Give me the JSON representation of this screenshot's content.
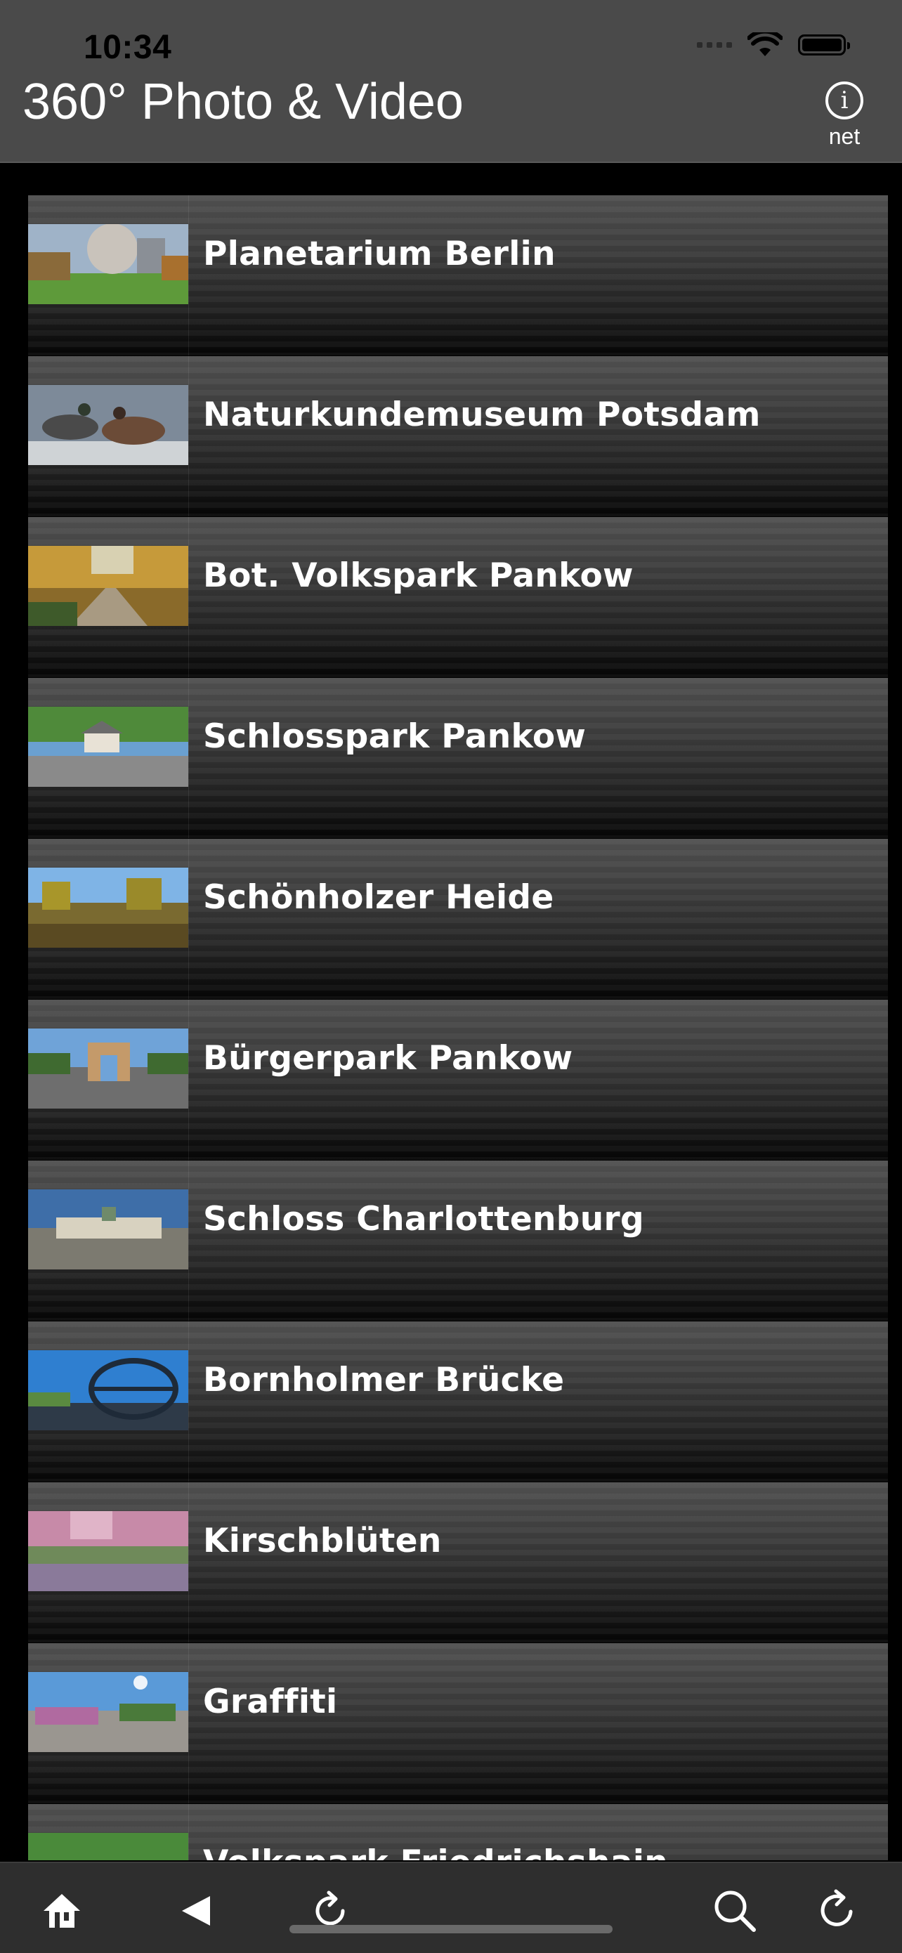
{
  "status_bar": {
    "time": "10:34"
  },
  "header": {
    "title": "360° Photo & Video",
    "info_button_label": "net"
  },
  "items": [
    {
      "label": "Planetarium Berlin"
    },
    {
      "label": "Naturkundemuseum Potsdam"
    },
    {
      "label": "Bot. Volkspark Pankow"
    },
    {
      "label": "Schlosspark Pankow"
    },
    {
      "label": "Schönholzer Heide"
    },
    {
      "label": "Bürgerpark Pankow"
    },
    {
      "label": "Schloss Charlottenburg"
    },
    {
      "label": "Bornholmer Brücke"
    },
    {
      "label": "Kirschblüten"
    },
    {
      "label": "Graffiti"
    },
    {
      "label": "Volkspark Friedrichshain"
    }
  ],
  "toolbar": {
    "icons": [
      "home-icon",
      "back-icon",
      "reload-icon",
      "search-icon",
      "refresh-icon"
    ]
  },
  "colors": {
    "header_background": "#4a4a4a",
    "page_background": "#000000",
    "toolbar_background": "#2e2e2e",
    "label_text": "#ffffff"
  }
}
